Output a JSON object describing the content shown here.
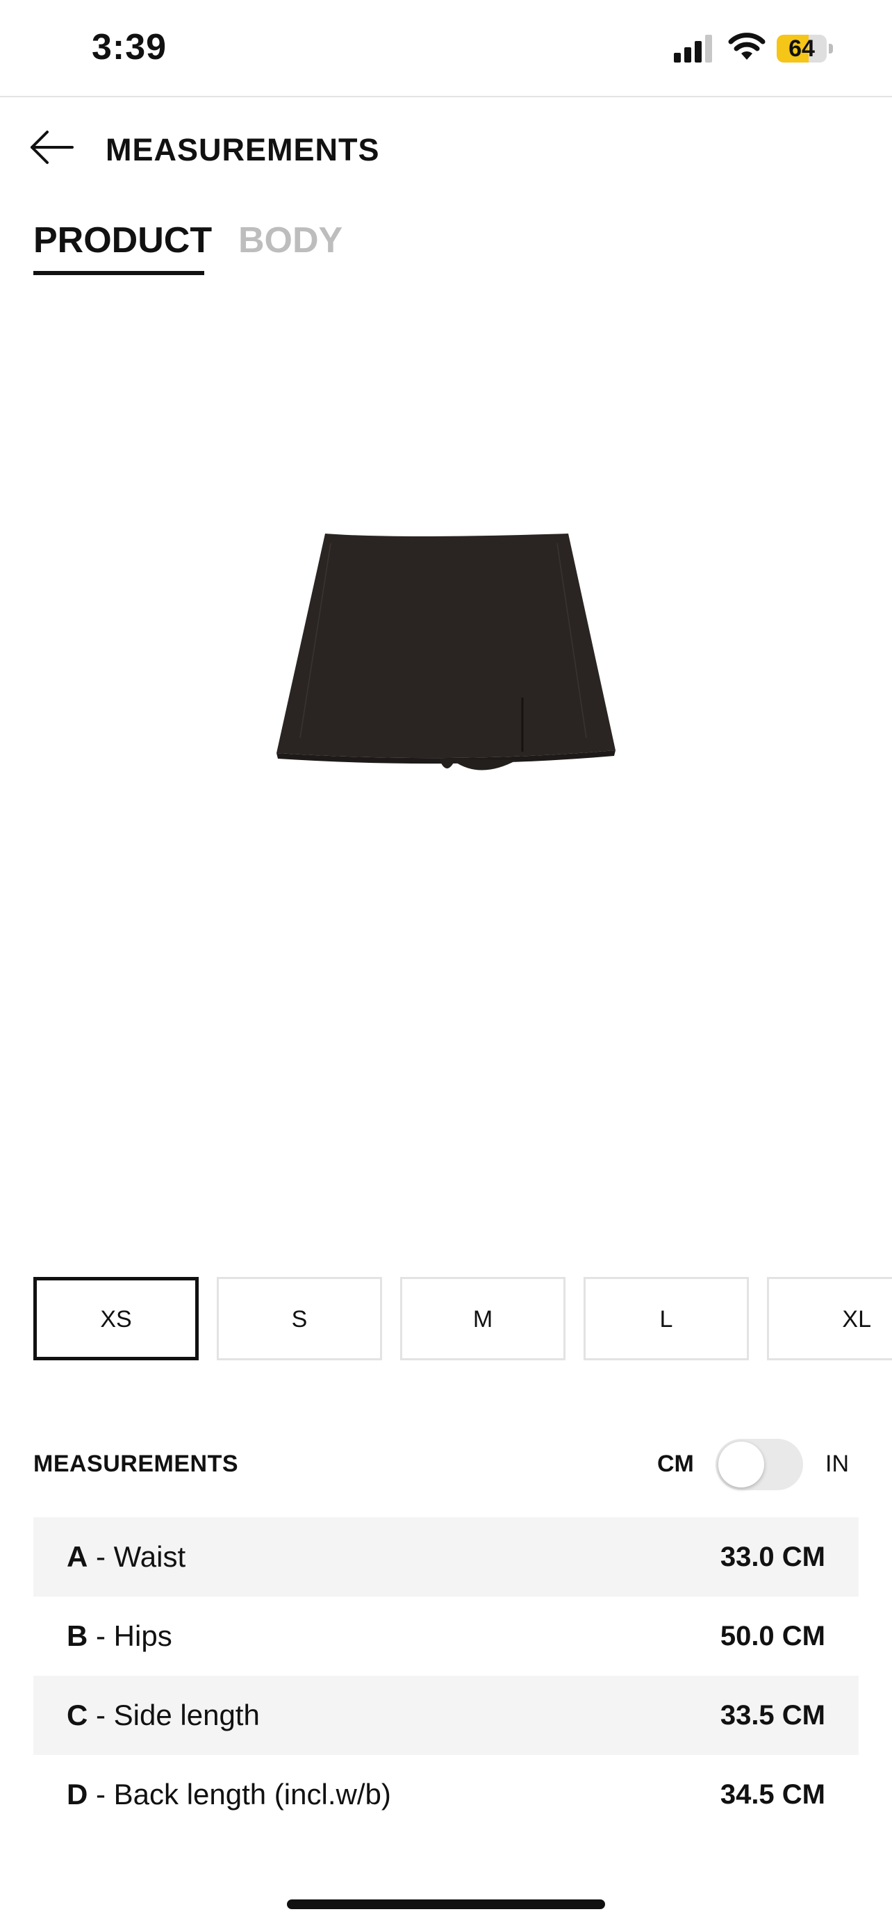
{
  "status_bar": {
    "time": "3:39",
    "battery_level": "64",
    "battery_fraction": 0.64,
    "battery_color": "#f5c518"
  },
  "header": {
    "back_icon": "arrow-left-icon",
    "title": "MEASUREMENTS"
  },
  "tabs": [
    {
      "label": "PRODUCT",
      "active": true
    },
    {
      "label": "BODY",
      "active": false
    }
  ],
  "product_image": {
    "subject": "black mini skirt",
    "color": "#2a2523"
  },
  "sizes": [
    {
      "label": "XS",
      "selected": true
    },
    {
      "label": "S",
      "selected": false
    },
    {
      "label": "M",
      "selected": false
    },
    {
      "label": "L",
      "selected": false
    },
    {
      "label": "XL",
      "selected": false
    }
  ],
  "measurements": {
    "title": "MEASUREMENTS",
    "unit_left": "CM",
    "unit_right": "IN",
    "toggle_on": false,
    "rows": [
      {
        "letter": "A",
        "name": " - Waist",
        "value": "33.0 CM"
      },
      {
        "letter": "B",
        "name": " - Hips",
        "value": "50.0 CM"
      },
      {
        "letter": "C",
        "name": " - Side length",
        "value": "33.5 CM"
      },
      {
        "letter": "D",
        "name": " - Back length (incl.w/b)",
        "value": "34.5 CM"
      }
    ]
  }
}
